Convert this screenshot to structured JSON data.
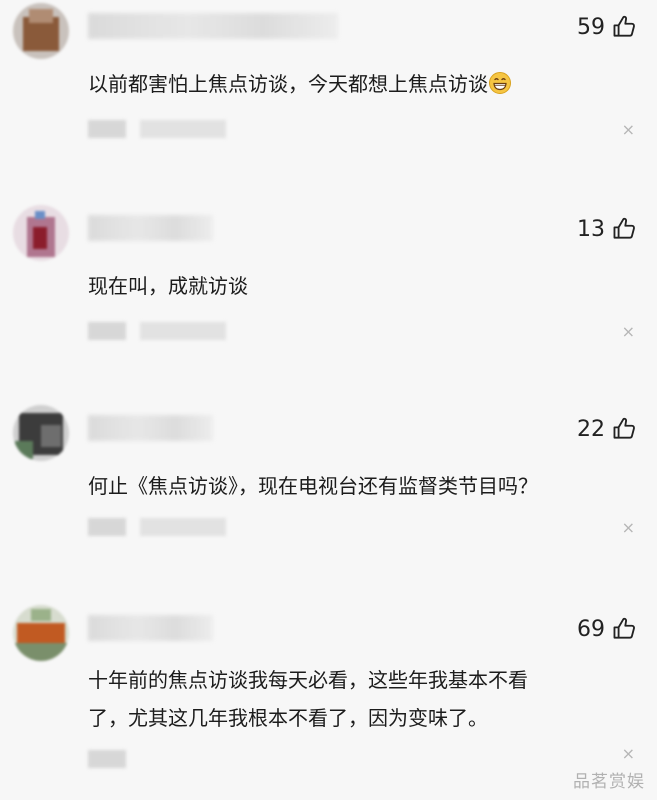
{
  "comments": [
    {
      "likes": "59",
      "text": "以前都害怕上焦点访谈，今天都想上焦点访谈",
      "has_emoji": true
    },
    {
      "likes": "13",
      "text": "现在叫，成就访谈"
    },
    {
      "likes": "22",
      "text": "何止《焦点访谈》，现在电视台还有监督类节目吗？"
    },
    {
      "likes": "69",
      "text_line1": "十年前的焦点访谈我每天必看，这些年我基本不看",
      "text_line2": "了，尤其这几年我根本不看了，因为变味了。"
    }
  ],
  "icons": {
    "like": "thumbs-up-icon",
    "close": "close-icon",
    "emoji": "grinning-face-emoji"
  },
  "close_glyph": "×",
  "watermark": "品茗赏娱",
  "colors": {
    "background": "#f7f7f7",
    "text": "#1c1c1c",
    "muted": "#b6b6b6",
    "emoji_face": "#f6c542"
  }
}
